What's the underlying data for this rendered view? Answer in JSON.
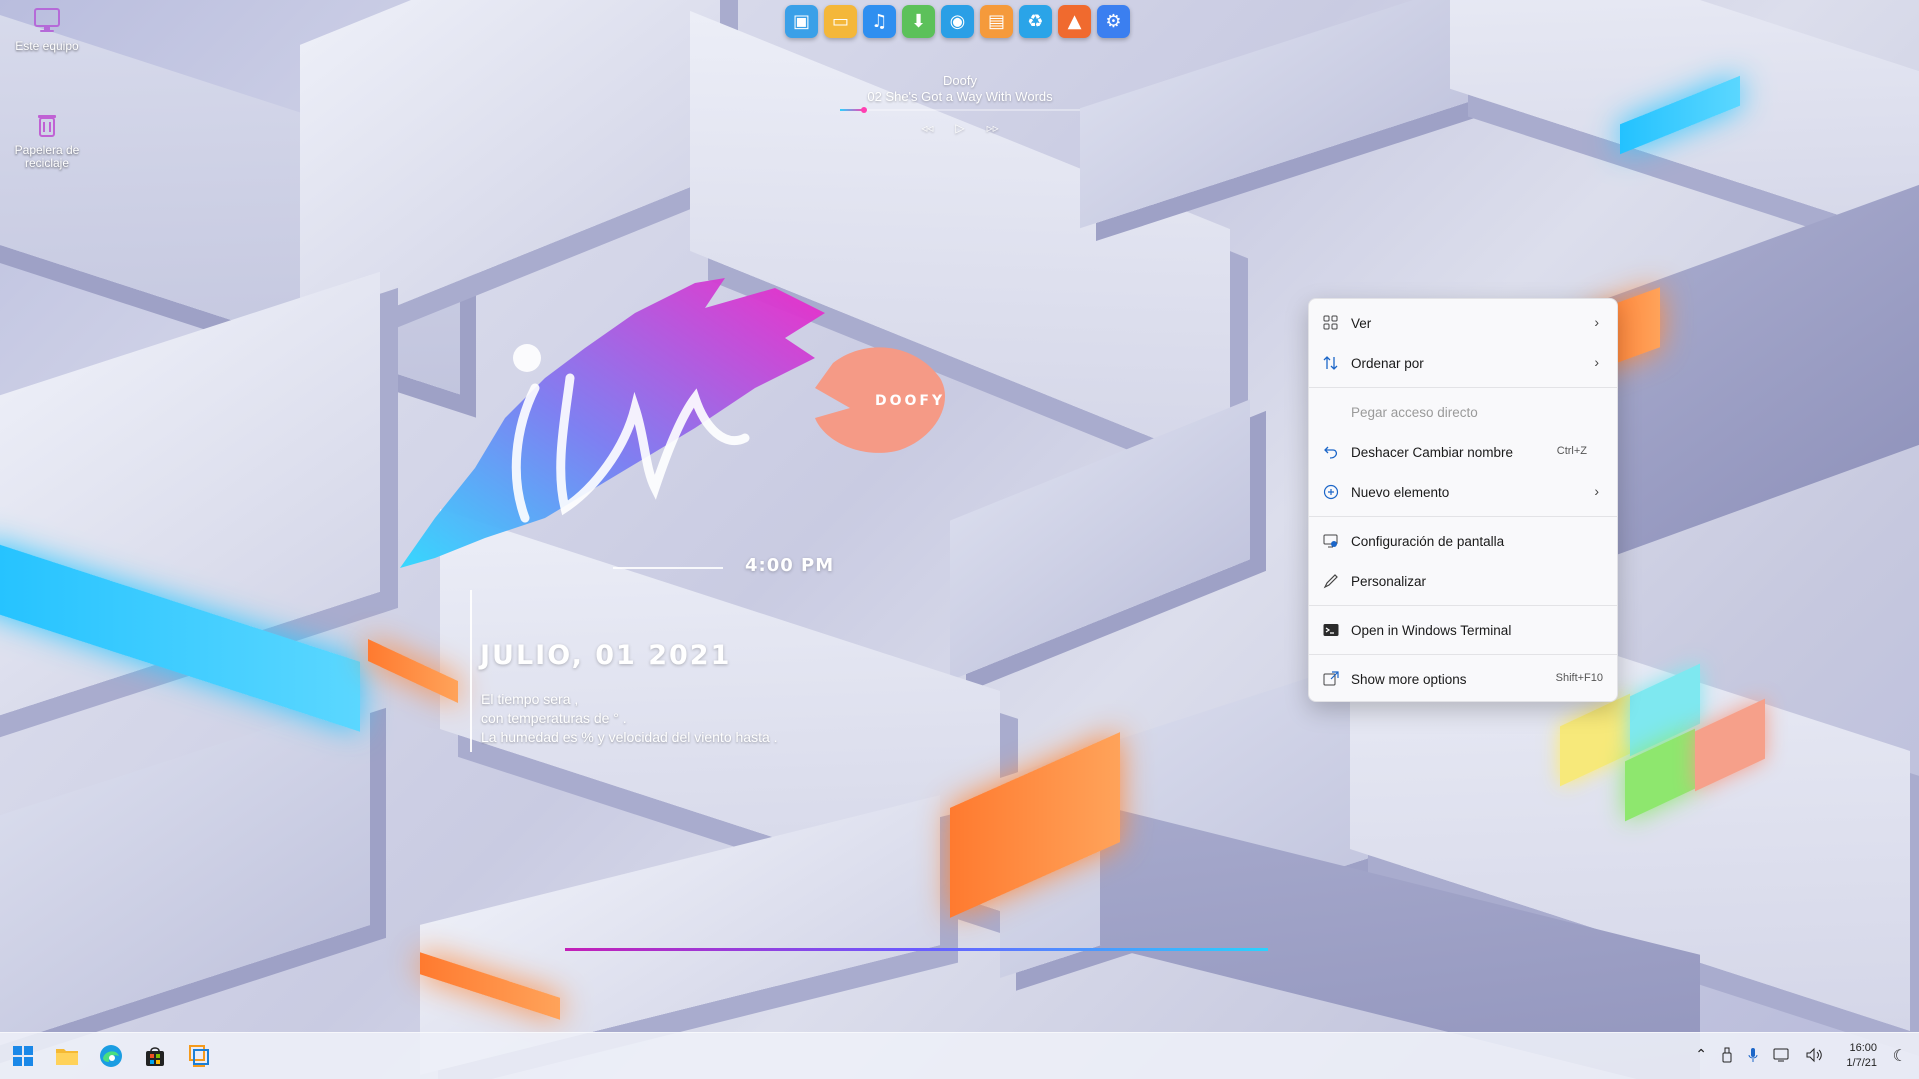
{
  "desktop": {
    "icons": [
      {
        "label": "Este equipo",
        "icon": "monitor-icon"
      },
      {
        "label": "Papelera de reciclaje",
        "icon": "recycle-bin-icon"
      }
    ]
  },
  "dock": {
    "items": [
      {
        "name": "desktop-preview-icon",
        "glyph": "▣",
        "color": "#3aa0e8"
      },
      {
        "name": "files-icon",
        "glyph": "▭",
        "color": "#f4b73a"
      },
      {
        "name": "music-icon",
        "glyph": "♫",
        "color": "#2f8ff0"
      },
      {
        "name": "downloads-icon",
        "glyph": "⬇",
        "color": "#5cc15a"
      },
      {
        "name": "camera-icon",
        "glyph": "◉",
        "color": "#2a9fe6"
      },
      {
        "name": "calendar-icon",
        "glyph": "▤",
        "color": "#f59a3b"
      },
      {
        "name": "recycle-icon",
        "glyph": "♻",
        "color": "#2aa4e8"
      },
      {
        "name": "rocket-icon",
        "glyph": "▲",
        "color": "#f06a2e"
      },
      {
        "name": "settings-icon",
        "glyph": "⚙",
        "color": "#3b7ff0"
      }
    ]
  },
  "music": {
    "artist": "Doofy",
    "track": "02 She's Got a Way With Words",
    "progress": 0.1,
    "controls": {
      "prev": "◃◃",
      "play": "▷",
      "next": "▹▹"
    }
  },
  "art": {
    "brand": "DOOFY"
  },
  "clock_widget": {
    "time": "4:00 PM",
    "date": "JULIO, 01 2021",
    "weather_lines": [
      "El tiempo sera ,",
      "con temperaturas de ° .",
      "La humedad es  % y velocidad del viento hasta  ."
    ]
  },
  "context_menu": {
    "items": [
      {
        "label": "Ver",
        "icon": "grid-icon",
        "chevron": "›"
      },
      {
        "label": "Ordenar por",
        "icon": "sort-icon",
        "chevron": "›"
      },
      {
        "label": "Pegar acceso directo",
        "disabled": true
      },
      {
        "label": "Deshacer Cambiar nombre",
        "icon": "undo-icon",
        "shortcut": "Ctrl+Z"
      },
      {
        "label": "Nuevo elemento",
        "icon": "new-item-icon",
        "chevron": "›"
      },
      {
        "label": "Configuración de pantalla",
        "icon": "display-settings-icon"
      },
      {
        "label": "Personalizar",
        "icon": "pen-icon"
      },
      {
        "label": "Open in Windows Terminal",
        "icon": "terminal-icon"
      },
      {
        "label": "Show more options",
        "icon": "more-options-icon",
        "shortcut": "Shift+F10"
      }
    ]
  },
  "taskbar": {
    "apps": [
      "start-icon",
      "file-explorer-icon",
      "edge-icon",
      "store-icon",
      "vmware-icon"
    ],
    "tray": [
      "chevron-up-icon",
      "usb-icon",
      "microphone-icon",
      "network-icon",
      "volume-icon"
    ],
    "clock_time": "16:00",
    "clock_date": "1/7/21"
  },
  "colors": {
    "accent_blue": "#2ec8ff",
    "accent_orange": "#ff8a3c",
    "accent_magenta": "#d42fc6",
    "coral": "#f59a86"
  }
}
